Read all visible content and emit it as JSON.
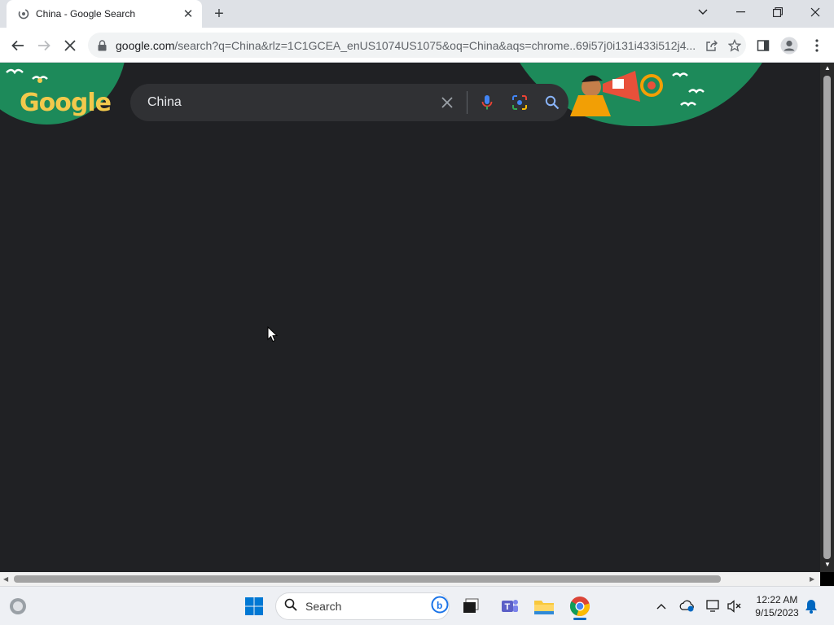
{
  "browser": {
    "tab_title": "China - Google Search",
    "url_host": "google.com",
    "url_rest": "/search?q=China&rlz=1C1GCEA_enUS1074US1075&oq=China&aqs=chrome..69i57j0i131i433i512j4..."
  },
  "page": {
    "logo_text": "Google",
    "search_value": "China"
  },
  "taskbar": {
    "search_label": "Search",
    "time": "12:22 AM",
    "date": "9/15/2023"
  },
  "colors": {
    "page_bg": "#202124",
    "doodle_green": "#1d8a5a",
    "searchbox_bg": "#303134"
  }
}
